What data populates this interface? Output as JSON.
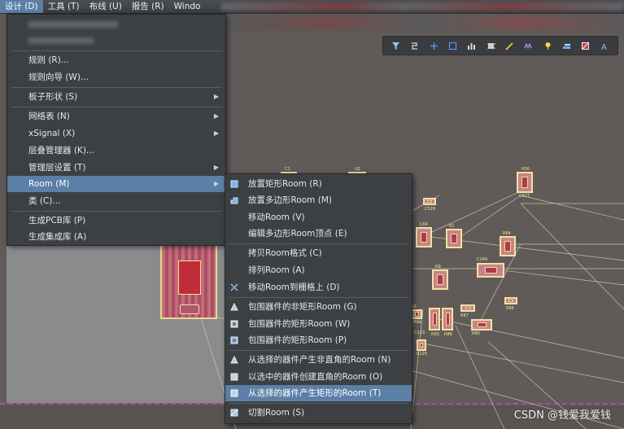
{
  "menubar": {
    "items": [
      {
        "label": "设计 (D)",
        "active": true
      },
      {
        "label": "工具 (T)"
      },
      {
        "label": "布线 (U)"
      },
      {
        "label": "报告 (R)"
      },
      {
        "label": "Windo"
      }
    ]
  },
  "design_menu": {
    "items": [
      {
        "label": "规则 (R)..."
      },
      {
        "label": "规则向导 (W)..."
      },
      {
        "label": "板子形状 (S)",
        "submenu": true
      },
      {
        "label": "网络表 (N)",
        "submenu": true
      },
      {
        "label": "xSignal (X)",
        "submenu": true
      },
      {
        "label": "层叠管理器 (K)..."
      },
      {
        "label": "管理层设置 (T)",
        "submenu": true
      },
      {
        "label": "Room (M)",
        "submenu": true,
        "highlighted": true
      },
      {
        "label": "类 (C)..."
      },
      {
        "label": "生成PCB库 (P)"
      },
      {
        "label": "生成集成库 (A)"
      }
    ]
  },
  "room_menu": {
    "items": [
      {
        "label": "放置矩形Room (R)",
        "icon": "rect-room-icon"
      },
      {
        "label": "放置多边形Room (M)",
        "icon": "polygon-room-icon"
      },
      {
        "label": "移动Room (V)"
      },
      {
        "label": "编辑多边形Room顶点 (E)"
      },
      {
        "label": "拷贝Room格式 (C)"
      },
      {
        "label": "排列Room (A)"
      },
      {
        "label": "移动Room到栅格上 (D)",
        "icon": "grid-move-icon"
      },
      {
        "label": "包围器件的非矩形Room (G)",
        "icon": "nonrect-wrap-icon"
      },
      {
        "label": "包围器件的矩形Room (W)",
        "icon": "rect-wrap-icon"
      },
      {
        "label": "包围器件的矩形Room (P)",
        "icon": "rect-wrap-p-icon"
      },
      {
        "label": "从选择的器件产生非直角的Room (N)",
        "icon": "nonright-room-icon"
      },
      {
        "label": "以选中的器件创建直角的Room (O)",
        "icon": "right-angle-room-icon"
      },
      {
        "label": "从选择的器件产生矩形的Room (T)",
        "icon": "rect-from-selection-icon",
        "highlighted": true
      },
      {
        "label": "切割Room (S)",
        "icon": "slice-room-icon"
      }
    ]
  },
  "toolbar": {
    "icons": [
      "filter-icon",
      "route-icon",
      "cross-icon",
      "rect-select-icon",
      "chart-icon",
      "chip-icon",
      "pen-icon",
      "wave-icon",
      "pin-icon",
      "layer-icon",
      "box-icon",
      "text-a-icon"
    ]
  },
  "pcb_labels": [
    "R56",
    "C527",
    "C64",
    "C528",
    "R1",
    "R84",
    "U2",
    "C1",
    "C149",
    "R9",
    "R93",
    "R88",
    "R87",
    "R9a",
    "R80",
    "R86",
    "R125",
    "C133",
    "R3"
  ],
  "watermark": "CSDN @钱爱我爱钱",
  "colors": {
    "accent": "#5b7fa6",
    "menu_bg": "#3d4043",
    "canvas": "#605b59"
  }
}
